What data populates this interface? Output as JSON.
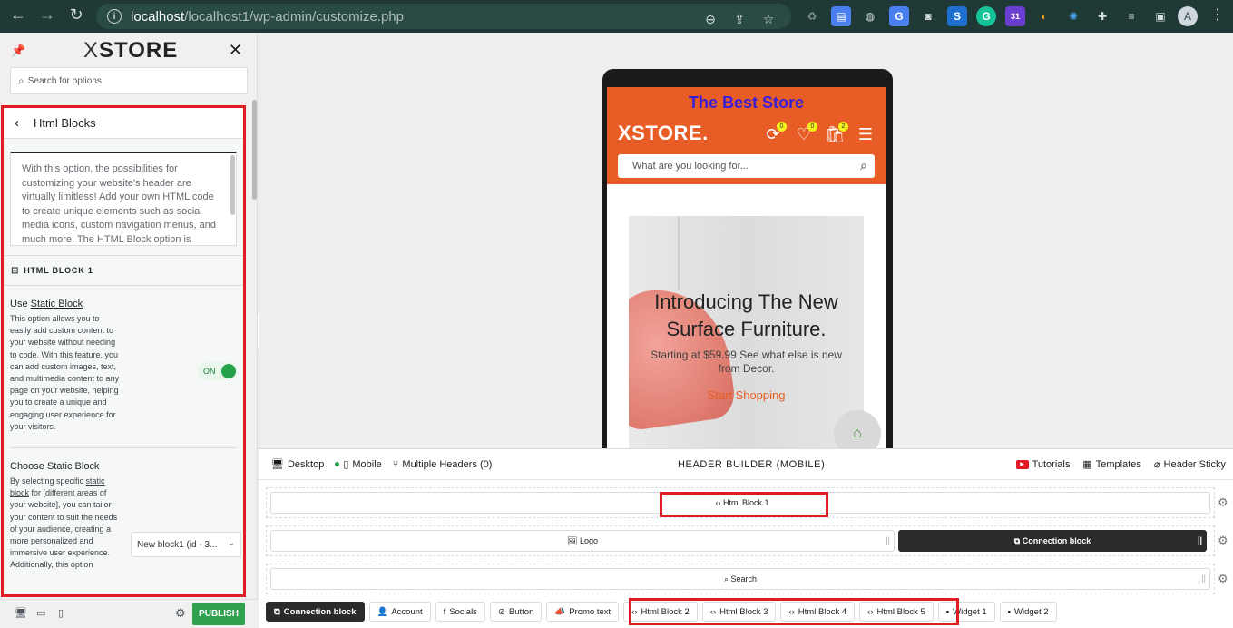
{
  "browser": {
    "url_host": "localhost",
    "url_path": "/localhost1/wp-admin/customize.php",
    "avatar_letter": "A",
    "calendar_badge": "31"
  },
  "sidebar": {
    "logo": "STORE",
    "logo_prefix": "X",
    "search_placeholder": "Search for options",
    "panel_title": "Html Blocks",
    "description": "With this option, the possibilities for customizing your website's header are virtually limitless! Add your own HTML code to create unique elements such as social media icons, custom navigation menus, and much more. The HTML Block option is",
    "block_section": "HTML BLOCK 1",
    "use_static": {
      "title_prefix": "Use ",
      "title_link": "Static Block",
      "desc": "This option allows you to easily add custom content to your website without needing to code. With this feature, you can add custom images, text, and multimedia content to any page on your website, helping you to create a unique and engaging user experience for your visitors.",
      "toggle_label": "ON"
    },
    "choose_static": {
      "title": "Choose Static Block",
      "desc_prefix": "By selecting specific ",
      "desc_link": "static block",
      "desc_rest": " for [different areas of your website], you can tailor your content to suit the needs of your audience, creating a more personalized and immersive user experience. Additionally, this option",
      "selected": "New block1 (id - 3..."
    },
    "publish_label": "PUBLISH"
  },
  "preview": {
    "top_text": "The Best Store",
    "logo": "XSTORE.",
    "badges": [
      "0",
      "0",
      "2"
    ],
    "search_placeholder": "What are you looking for...",
    "hero_title_1": "Introducing The New",
    "hero_title_2": "Surface Furniture.",
    "hero_sub_1": "Starting at $59.99 See what else is new",
    "hero_sub_2": "from Decor.",
    "hero_cta": "Start Shopping"
  },
  "builder": {
    "desktop": "Desktop",
    "mobile": "Mobile",
    "multiple_headers": "Multiple Headers (0)",
    "title": "HEADER BUILDER (MOBILE)",
    "tutorials": "Tutorials",
    "templates": "Templates",
    "sticky": "Header Sticky",
    "row1_slot": "Html Block 1",
    "row2_logo": "Logo",
    "row2_connection": "Connection block",
    "row3_search": "Search",
    "pool": [
      {
        "label": "Connection block",
        "icon": "stack-icon",
        "glyph": "⧉",
        "dark": true
      },
      {
        "label": "Account",
        "icon": "user-icon",
        "glyph": "👤",
        "dark": false
      },
      {
        "label": "Socials",
        "icon": "facebook-icon",
        "glyph": "f",
        "dark": false
      },
      {
        "label": "Button",
        "icon": "button-icon",
        "glyph": "⊘",
        "dark": false
      },
      {
        "label": "Promo text",
        "icon": "megaphone-icon",
        "glyph": "📣",
        "dark": false
      },
      {
        "label": "Html Block 2",
        "icon": "code-icon",
        "glyph": "‹›",
        "dark": false
      },
      {
        "label": "Html Block 3",
        "icon": "code-icon",
        "glyph": "‹›",
        "dark": false
      },
      {
        "label": "Html Block 4",
        "icon": "code-icon",
        "glyph": "‹›",
        "dark": false
      },
      {
        "label": "Html Block 5",
        "icon": "code-icon",
        "glyph": "‹›",
        "dark": false
      },
      {
        "label": "Widget 1",
        "icon": "folder-icon",
        "glyph": "▪",
        "dark": false
      },
      {
        "label": "Widget 2",
        "icon": "folder-icon",
        "glyph": "▪",
        "dark": false
      }
    ]
  },
  "colors": {
    "brand_orange": "#e85d26",
    "highlight_red": "#e01b24",
    "toggle_green": "#25a14a",
    "publish_green": "#30a14e"
  }
}
